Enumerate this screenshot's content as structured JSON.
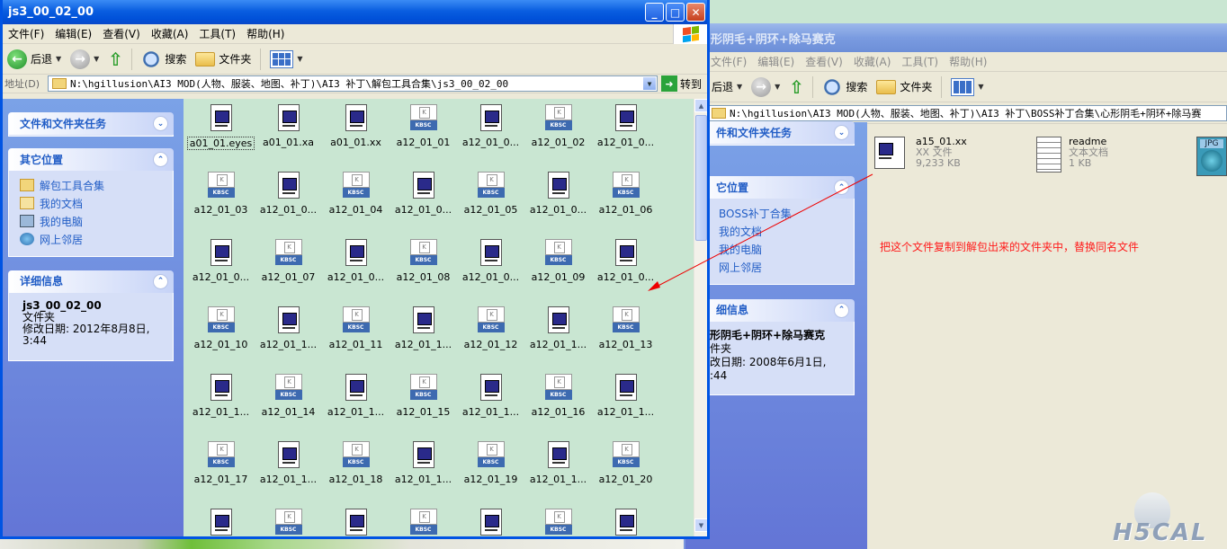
{
  "front": {
    "title": "js3_00_02_00",
    "menu": [
      "文件(F)",
      "编辑(E)",
      "查看(V)",
      "收藏(A)",
      "工具(T)",
      "帮助(H)"
    ],
    "toolbar": {
      "back": "后退",
      "search": "搜索",
      "folders": "文件夹"
    },
    "address": {
      "label": "地址(D)",
      "value": "N:\\hgillusion\\AI3 MOD(人物、服装、地图、补丁)\\AI3 补丁\\解包工具合集\\js3_00_02_00",
      "go": "转到"
    },
    "tasks_title": "文件和文件夹任务",
    "places_title": "其它位置",
    "places": [
      "解包工具合集",
      "我的文档",
      "我的电脑",
      "网上邻居"
    ],
    "details_title": "详细信息",
    "details": {
      "name": "js3_00_02_00",
      "type": "文件夹",
      "date": "修改日期: 2012年8月8日,",
      "time": "3:44"
    },
    "files": [
      {
        "name": "a01_01.eyes",
        "icon": "doc"
      },
      {
        "name": "a01_01.xa",
        "icon": "doc"
      },
      {
        "name": "a01_01.xx",
        "icon": "doc"
      },
      {
        "name": "a12_01_01",
        "icon": "kbsc"
      },
      {
        "name": "a12_01_0...",
        "icon": "doc"
      },
      {
        "name": "a12_01_02",
        "icon": "kbsc"
      },
      {
        "name": "a12_01_0...",
        "icon": "doc"
      },
      {
        "name": "a12_01_03",
        "icon": "kbsc"
      },
      {
        "name": "a12_01_0...",
        "icon": "doc"
      },
      {
        "name": "a12_01_04",
        "icon": "kbsc"
      },
      {
        "name": "a12_01_0...",
        "icon": "doc"
      },
      {
        "name": "a12_01_05",
        "icon": "kbsc"
      },
      {
        "name": "a12_01_0...",
        "icon": "doc"
      },
      {
        "name": "a12_01_06",
        "icon": "kbsc"
      },
      {
        "name": "a12_01_0...",
        "icon": "doc"
      },
      {
        "name": "a12_01_07",
        "icon": "kbsc"
      },
      {
        "name": "a12_01_0...",
        "icon": "doc"
      },
      {
        "name": "a12_01_08",
        "icon": "kbsc"
      },
      {
        "name": "a12_01_0...",
        "icon": "doc"
      },
      {
        "name": "a12_01_09",
        "icon": "kbsc"
      },
      {
        "name": "a12_01_0...",
        "icon": "doc"
      },
      {
        "name": "a12_01_10",
        "icon": "kbsc"
      },
      {
        "name": "a12_01_1...",
        "icon": "doc"
      },
      {
        "name": "a12_01_11",
        "icon": "kbsc"
      },
      {
        "name": "a12_01_1...",
        "icon": "doc"
      },
      {
        "name": "a12_01_12",
        "icon": "kbsc"
      },
      {
        "name": "a12_01_1...",
        "icon": "doc"
      },
      {
        "name": "a12_01_13",
        "icon": "kbsc"
      },
      {
        "name": "a12_01_1...",
        "icon": "doc"
      },
      {
        "name": "a12_01_14",
        "icon": "kbsc"
      },
      {
        "name": "a12_01_1...",
        "icon": "doc"
      },
      {
        "name": "a12_01_15",
        "icon": "kbsc"
      },
      {
        "name": "a12_01_1...",
        "icon": "doc"
      },
      {
        "name": "a12_01_16",
        "icon": "kbsc"
      },
      {
        "name": "a12_01_1...",
        "icon": "doc"
      },
      {
        "name": "a12_01_17",
        "icon": "kbsc"
      },
      {
        "name": "a12_01_1...",
        "icon": "doc"
      },
      {
        "name": "a12_01_18",
        "icon": "kbsc"
      },
      {
        "name": "a12_01_1...",
        "icon": "doc"
      },
      {
        "name": "a12_01_19",
        "icon": "kbsc"
      },
      {
        "name": "a12_01_1...",
        "icon": "doc"
      },
      {
        "name": "a12_01_20",
        "icon": "kbsc"
      },
      {
        "name": "",
        "icon": "doc"
      },
      {
        "name": "",
        "icon": "kbsc"
      },
      {
        "name": "",
        "icon": "doc"
      },
      {
        "name": "",
        "icon": "kbsc"
      },
      {
        "name": "",
        "icon": "doc"
      },
      {
        "name": "",
        "icon": "kbsc"
      },
      {
        "name": "",
        "icon": "doc"
      }
    ]
  },
  "back": {
    "title": "形阴毛+阴环+除马赛克",
    "menu": [
      "文件(F)",
      "编辑(E)",
      "查看(V)",
      "收藏(A)",
      "工具(T)",
      "帮助(H)"
    ],
    "toolbar": {
      "back": "后退",
      "search": "搜索",
      "folders": "文件夹"
    },
    "address": "N:\\hgillusion\\AI3 MOD(人物、服装、地图、补丁)\\AI3 补丁\\BOSS补丁合集\\心形阴毛+阴环+除马赛",
    "tasks_title": "件和文件夹任务",
    "places_title": "它位置",
    "places": [
      "BOSS补丁合集",
      "我的文档",
      "我的电脑",
      "网上邻居"
    ],
    "details_title": "细信息",
    "details": {
      "name": "形阴毛+阴环+除马赛克",
      "type": "件夹",
      "date": "改日期: 2008年6月1日,",
      "time": ":44"
    },
    "files": [
      {
        "name": "a15_01.xx",
        "type": "XX 文件",
        "size": "9,233 KB"
      },
      {
        "name": "readme",
        "type": "文本文档",
        "size": "1 KB"
      },
      {
        "name": "JPG",
        "type": "",
        "size": ""
      }
    ]
  },
  "annotation": "把这个文件复制到解包出来的文件夹中，替换同名文件",
  "watermark": "H5CAL",
  "colors": {
    "titlebar": "#0a5ee0",
    "annotation": "#ff1a1a",
    "background": "#c9e6d2"
  }
}
